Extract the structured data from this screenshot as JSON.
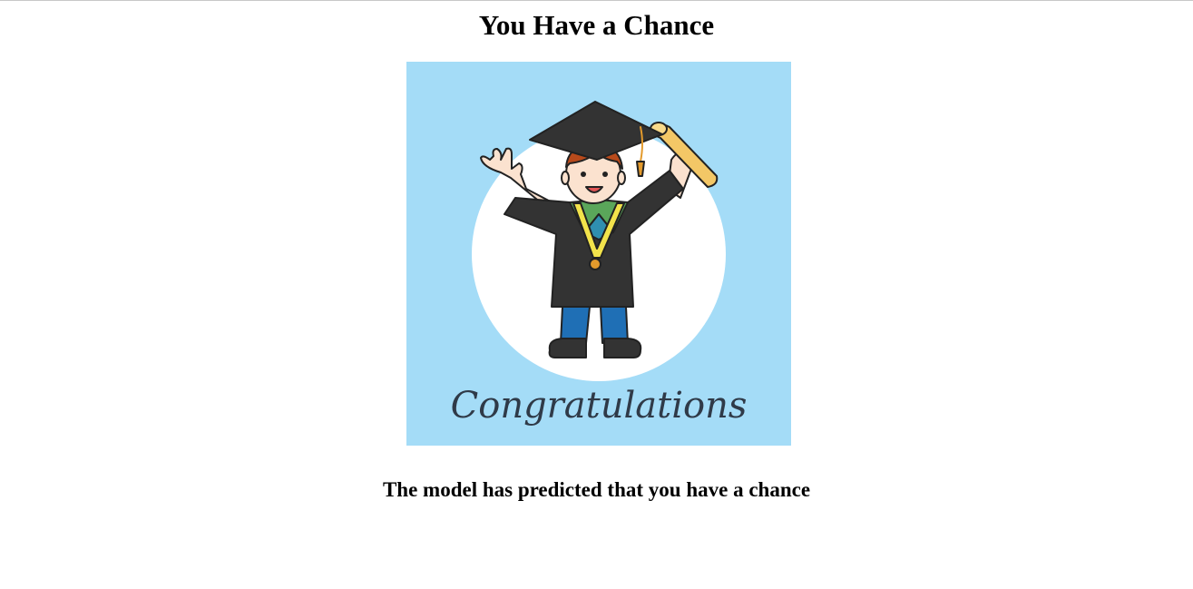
{
  "page": {
    "title": "You Have a Chance",
    "message": "The model has predicted that you have a chance"
  },
  "illustration": {
    "caption": "Congratulations",
    "subject": "graduate-icon",
    "colors": {
      "background": "#a4dcf7",
      "circle": "#ffffff",
      "gown": "#333333",
      "pants": "#1f6fb5",
      "diploma": "#f3c766",
      "medal_ribbon": "#f2e34b",
      "medal": "#e39a2c",
      "stole": "#5aa65a",
      "hair": "#b84a1b",
      "skin": "#fbe2cf"
    }
  }
}
